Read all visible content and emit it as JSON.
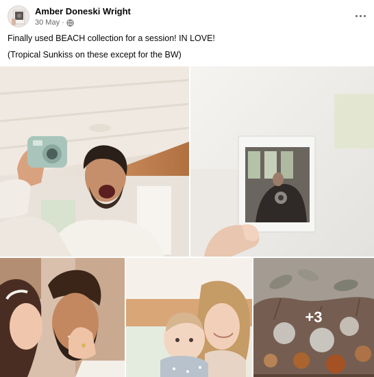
{
  "post": {
    "author_name": "Amber Doneski Wright",
    "date": "30 May",
    "separator": "·",
    "privacy_icon": "globe-icon",
    "menu_icon": "more-options-icon",
    "text_line1": "Finally used BEACH collection for a session! IN LOVE!",
    "text_line2": "(Tropical Sunkiss on these except for the BW)"
  },
  "photos": [
    {
      "subject": "man laughing holding instant camera"
    },
    {
      "subject": "hand holding instant photo print"
    },
    {
      "subject": "couple face to face"
    },
    {
      "subject": "mother with baby"
    },
    {
      "subject": "dried flower bouquet",
      "more_count": "+3"
    }
  ]
}
